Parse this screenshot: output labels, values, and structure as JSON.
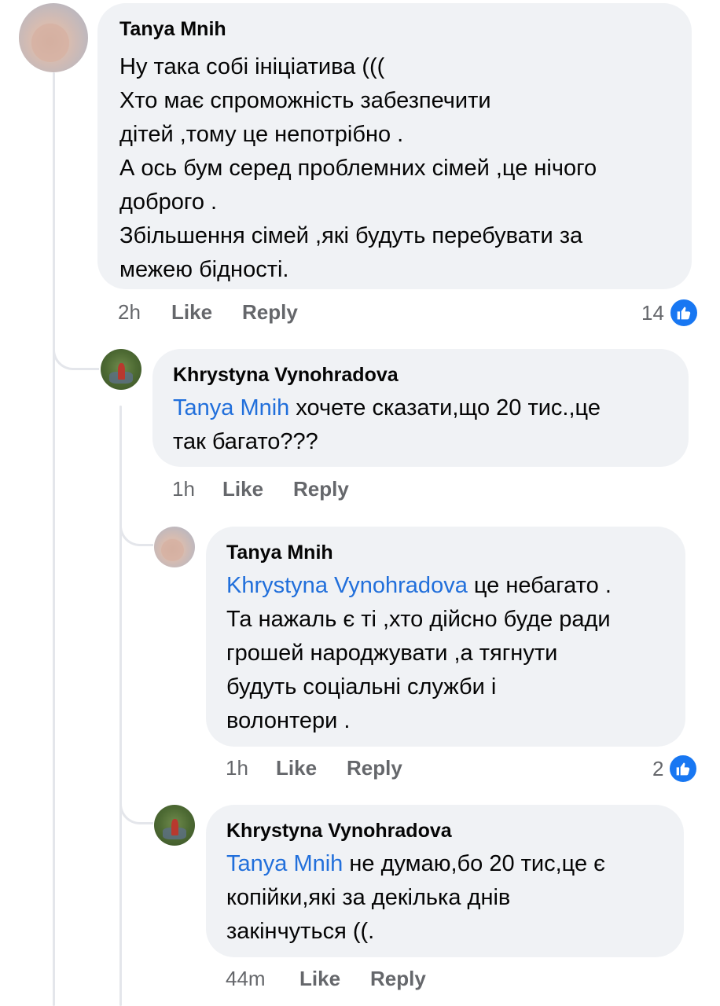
{
  "comments": [
    {
      "author": "Tanya  Mnih",
      "mention": "",
      "text": "Ну така собі ініціатива (((\nХто має спроможність забезпечити\nдітей ,тому це непотрібно .\nА ось бум серед проблемних сімей ,це нічого\nдоброго .\nЗбільшення сімей ,які будуть перебувати за\nмежею бідності.",
      "time": "2h",
      "like_label": "Like",
      "reply_label": "Reply",
      "reactions": "14"
    },
    {
      "author": "Khrystyna Vynohradova",
      "mention": "Tanya  Mnih",
      "text": " хочете сказати,що 20 тис.,це\nтак багато???",
      "time": "1h",
      "like_label": "Like",
      "reply_label": "Reply",
      "reactions": ""
    },
    {
      "author": "Tanya  Mnih",
      "mention": "Khrystyna Vynohradova",
      "text": " це небагато .\nТа нажаль є ті ,хто дійсно буде ради\nгрошей народжувати ,а тягнути\nбудуть соціальні служби і\nволонтери .",
      "time": "1h",
      "like_label": "Like",
      "reply_label": "Reply",
      "reactions": "2"
    },
    {
      "author": "Khrystyna Vynohradova",
      "mention": "Tanya  Mnih",
      "text": " не думаю,бо 20 тис,це є\nкопійки,які за декілька днів\nзакінчуться ((.",
      "time": "44m",
      "like_label": "Like",
      "reply_label": "Reply",
      "reactions": ""
    }
  ],
  "icons": {
    "reaction": "like-thumbs-up-icon",
    "reaction_color": "#1877f2"
  },
  "colors": {
    "bubble": "#f0f2f5",
    "mention": "#216fdb",
    "meta": "#65676b"
  }
}
